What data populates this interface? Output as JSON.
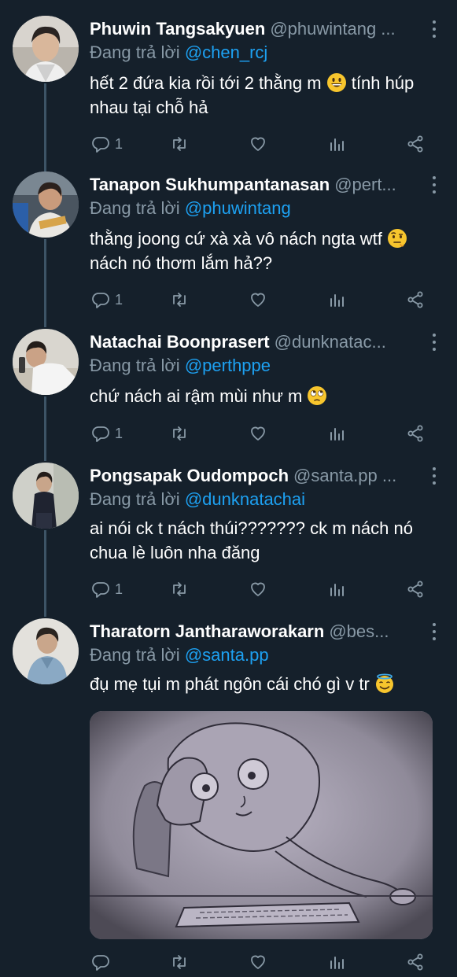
{
  "reply_prefix": "Đang trả lời",
  "tweets": [
    {
      "name": "Phuwin Tangsakyuen",
      "handle": "@phuwintang ...",
      "reply_to": "@chen_rcj",
      "text": "hết 2 đứa kia rồi tới 2 thằng m",
      "text_after": " tính húp nhau tại chỗ hả",
      "emoji": "grinning-face-icon",
      "reply_count": "1"
    },
    {
      "name": "Tanapon Sukhumpantanasan",
      "handle": "@pert...",
      "reply_to": "@phuwintang",
      "text": "thằng joong cứ xà xà vô nách ngta wtf",
      "text_after": " nách nó thơm lắm hả??",
      "emoji": "face-with-raised-eyebrow-icon",
      "reply_count": "1"
    },
    {
      "name": "Natachai Boonprasert",
      "handle": "@dunknatac...",
      "reply_to": "@perthppe",
      "text": "chứ nách ai rậm mùi như m",
      "text_after": "",
      "emoji": "face-with-rolling-eyes-icon",
      "reply_count": "1"
    },
    {
      "name": "Pongsapak Oudompoch",
      "handle": "@santa.pp ...",
      "reply_to": "@dunknatachai",
      "text": "ai nói ck t nách thúi??????? ck m nách nó chua lè luôn nha đăng",
      "text_after": "",
      "emoji": "",
      "reply_count": "1"
    },
    {
      "name": "Tharatorn Jantharaworakarn",
      "handle": "@bes...",
      "reply_to": "@santa.pp",
      "text": "đụ mẹ tụi m phát ngôn cái chó gì v tr",
      "text_after": "",
      "emoji": "smiling-face-with-halo-icon",
      "reply_count": ""
    }
  ],
  "colors": {
    "background": "#15202b",
    "secondary_text": "#8899a6",
    "link": "#1da1f2",
    "thread_line": "#3d5466"
  }
}
